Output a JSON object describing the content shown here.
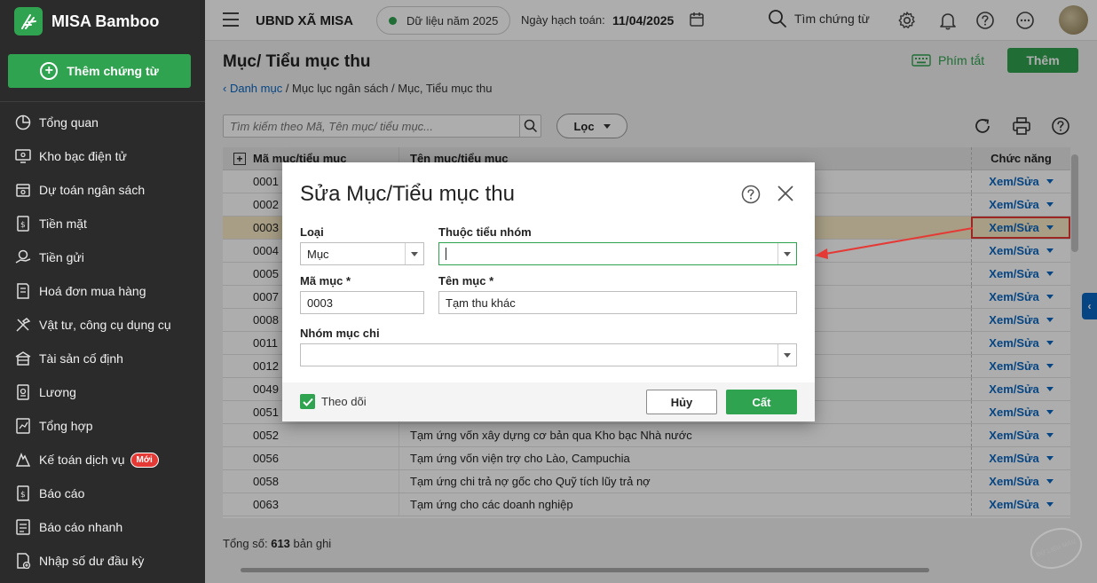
{
  "app": {
    "brand": "MISA Bamboo",
    "add_voucher_label": "Thêm chứng từ"
  },
  "sidebar": {
    "items": [
      {
        "label": "Tổng quan",
        "icon": "pie-chart-icon"
      },
      {
        "label": "Kho bạc điện tử",
        "icon": "monitor-icon"
      },
      {
        "label": "Dự toán ngân sách",
        "icon": "budget-icon"
      },
      {
        "label": "Tiền mặt",
        "icon": "cash-icon"
      },
      {
        "label": "Tiền gửi",
        "icon": "deposit-icon"
      },
      {
        "label": "Hoá đơn mua hàng",
        "icon": "invoice-icon"
      },
      {
        "label": "Vật tư, công cụ dụng cụ",
        "icon": "tools-icon"
      },
      {
        "label": "Tài sản cố định",
        "icon": "building-icon"
      },
      {
        "label": "Lương",
        "icon": "salary-icon"
      },
      {
        "label": "Tổng hợp",
        "icon": "summary-icon"
      },
      {
        "label": "Kế toán dịch vụ",
        "icon": "service-icon",
        "badge": "Mới"
      },
      {
        "label": "Báo cáo",
        "icon": "report-icon"
      },
      {
        "label": "Báo cáo nhanh",
        "icon": "quick-report-icon"
      },
      {
        "label": "Nhập số dư đầu kỳ",
        "icon": "opening-balance-icon"
      }
    ]
  },
  "topbar": {
    "org_name": "UBND XÃ MISA",
    "data_year": "Dữ liệu năm 2025",
    "posting_date_label": "Ngày hạch toán:",
    "posting_date": "11/04/2025",
    "search_label": "Tìm chứng từ"
  },
  "page": {
    "title": "Mục/ Tiểu mục thu",
    "breadcrumb": {
      "back_label": "Danh mục",
      "rest": " / Mục lục ngân sách / Mục, Tiểu mục thu"
    },
    "shortcut_label": "Phím tắt",
    "add_label": "Thêm",
    "search_placeholder": "Tìm kiếm theo Mã, Tên mục/ tiểu mục...",
    "filter_label": "Lọc",
    "total_label": "Tổng số:",
    "total_count": "613",
    "total_suffix": "bản ghi"
  },
  "table": {
    "headers": {
      "code": "Mã mục/tiểu mục",
      "name": "Tên mục/tiểu mục",
      "action": "Chức năng"
    },
    "action_label": "Xem/Sửa",
    "rows": [
      {
        "code": "0001",
        "name": ""
      },
      {
        "code": "0002",
        "name": ""
      },
      {
        "code": "0003",
        "name": "",
        "selected": true
      },
      {
        "code": "0004",
        "name": ""
      },
      {
        "code": "0005",
        "name": ""
      },
      {
        "code": "0007",
        "name": ""
      },
      {
        "code": "0008",
        "name": ""
      },
      {
        "code": "0011",
        "name": ""
      },
      {
        "code": "0012",
        "name": ""
      },
      {
        "code": "0049",
        "name": ""
      },
      {
        "code": "0051",
        "name": ""
      },
      {
        "code": "0052",
        "name": "Tạm ứng vốn xây dựng cơ bản qua Kho bạc Nhà nước"
      },
      {
        "code": "0056",
        "name": "Tạm ứng vốn viện trợ cho Lào, Campuchia"
      },
      {
        "code": "0058",
        "name": "Tạm ứng chi trả nợ gốc cho Quỹ tích lũy trả nợ"
      },
      {
        "code": "0063",
        "name": "Tạm ứng cho các doanh nghiệp"
      }
    ]
  },
  "dialog": {
    "title": "Sửa Mục/Tiểu mục thu",
    "type_label": "Loại",
    "type_value": "Mục",
    "group_label": "Thuộc tiểu nhóm",
    "group_value": "",
    "code_label": "Mã mục *",
    "code_value": "0003",
    "name_label": "Tên mục *",
    "name_value": "Tạm thu khác",
    "expense_group_label": "Nhóm mục chi",
    "expense_group_value": "",
    "track_label": "Theo dõi",
    "cancel_label": "Hủy",
    "save_label": "Cất"
  },
  "watermark": "DỮ LIỆU MẪU",
  "colors": {
    "accent": "#30a350",
    "link": "#0a66c2",
    "highlight": "#e53935",
    "sidebar": "#2b2b2b"
  }
}
